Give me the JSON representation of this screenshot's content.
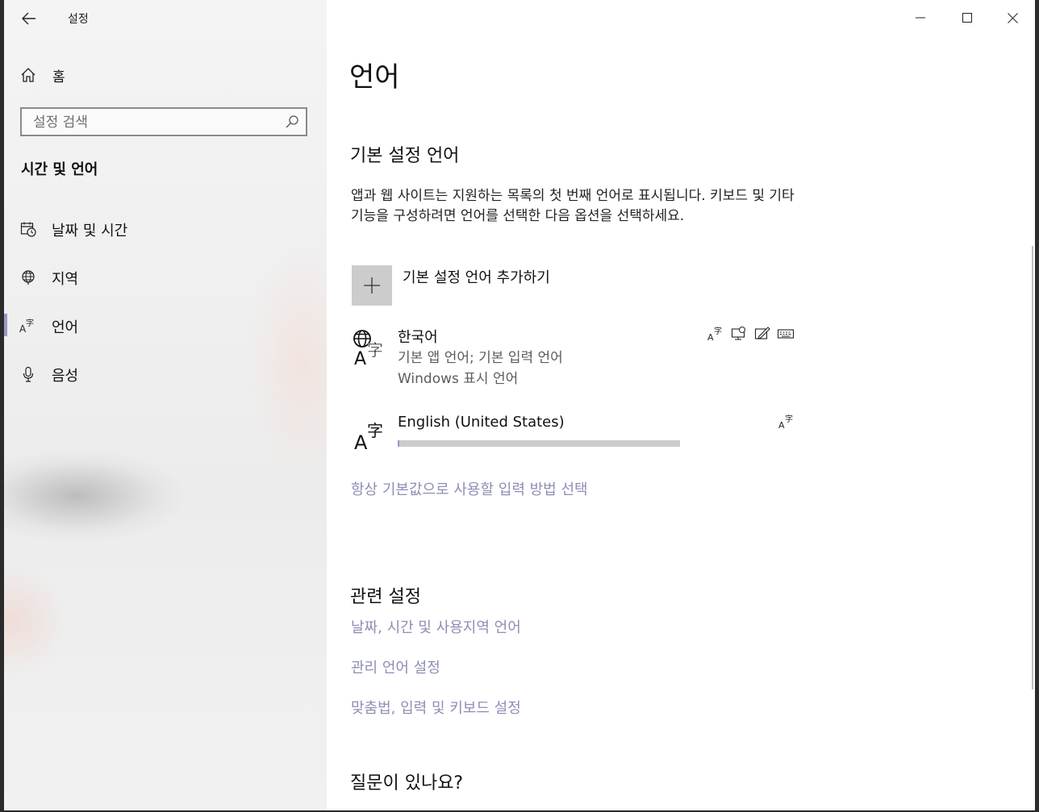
{
  "window": {
    "title": "설정",
    "controls": {
      "minimize_icon": "minimize-icon",
      "maximize_icon": "maximize-icon",
      "close_icon": "close-icon"
    }
  },
  "sidebar": {
    "home_label": "홈",
    "search_placeholder": "설정 검색",
    "section_title": "시간 및 언어",
    "items": [
      {
        "label": "날짜 및 시간",
        "icon": "calendar-clock-icon",
        "active": false
      },
      {
        "label": "지역",
        "icon": "globe-region-icon",
        "active": false
      },
      {
        "label": "언어",
        "icon": "language-icon",
        "active": true
      },
      {
        "label": "음성",
        "icon": "microphone-icon",
        "active": false
      }
    ]
  },
  "main": {
    "page_title": "언어",
    "preferred_heading": "기본 설정 언어",
    "preferred_desc": "앱과 웹 사이트는 지원하는 목록의 첫 번째 언어로 표시됩니다. 키보드 및 기타 기능을 구성하려면 언어를 선택한 다음 옵션을 선택하세요.",
    "add_language_label": "기본 설정 언어 추가하기",
    "languages": [
      {
        "name": "한국어",
        "sub1": "기본 앱 언어; 기본 입력 언어",
        "sub2": "Windows 표시 언어",
        "features": [
          "language-pack-icon",
          "speech-icon",
          "handwriting-icon",
          "keyboard-icon"
        ]
      },
      {
        "name": "English (United States)",
        "features": [
          "language-pack-icon"
        ],
        "download_progress": 0.005
      }
    ],
    "default_input_link": "항상 기본값으로 사용할 입력 방법 선택",
    "related_heading": "관련 설정",
    "related_links": [
      "날짜, 시간 및 사용지역 언어",
      "관리 언어 설정",
      "맞춤법, 입력 및 키보드 설정"
    ],
    "question_heading": "질문이 있나요?",
    "accent_color": "#9a9ac6",
    "link_color": "#8e8eb4"
  }
}
